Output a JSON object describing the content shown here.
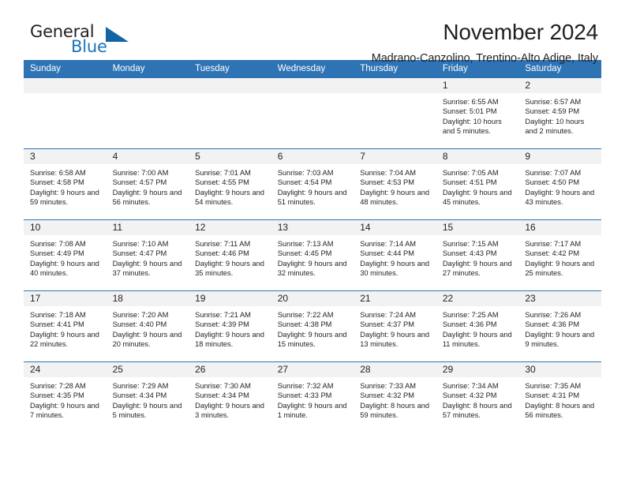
{
  "brand": {
    "name_part1": "General",
    "name_part2": "Blue",
    "logo_icon": "blue-triangle-icon"
  },
  "header": {
    "month_title": "November 2024",
    "location": "Madrano-Canzolino, Trentino-Alto Adige, Italy"
  },
  "colors": {
    "header_blue": "#2e74b5",
    "brand_blue": "#1a74bb",
    "daynum_bg": "#f2f2f2",
    "text": "#231f20"
  },
  "calendar": {
    "weekday_headers": [
      "Sunday",
      "Monday",
      "Tuesday",
      "Wednesday",
      "Thursday",
      "Friday",
      "Saturday"
    ],
    "weeks": [
      [
        {
          "day": "",
          "sunrise": "",
          "sunset": "",
          "daylight": ""
        },
        {
          "day": "",
          "sunrise": "",
          "sunset": "",
          "daylight": ""
        },
        {
          "day": "",
          "sunrise": "",
          "sunset": "",
          "daylight": ""
        },
        {
          "day": "",
          "sunrise": "",
          "sunset": "",
          "daylight": ""
        },
        {
          "day": "",
          "sunrise": "",
          "sunset": "",
          "daylight": ""
        },
        {
          "day": "1",
          "sunrise": "Sunrise: 6:55 AM",
          "sunset": "Sunset: 5:01 PM",
          "daylight": "Daylight: 10 hours and 5 minutes."
        },
        {
          "day": "2",
          "sunrise": "Sunrise: 6:57 AM",
          "sunset": "Sunset: 4:59 PM",
          "daylight": "Daylight: 10 hours and 2 minutes."
        }
      ],
      [
        {
          "day": "3",
          "sunrise": "Sunrise: 6:58 AM",
          "sunset": "Sunset: 4:58 PM",
          "daylight": "Daylight: 9 hours and 59 minutes."
        },
        {
          "day": "4",
          "sunrise": "Sunrise: 7:00 AM",
          "sunset": "Sunset: 4:57 PM",
          "daylight": "Daylight: 9 hours and 56 minutes."
        },
        {
          "day": "5",
          "sunrise": "Sunrise: 7:01 AM",
          "sunset": "Sunset: 4:55 PM",
          "daylight": "Daylight: 9 hours and 54 minutes."
        },
        {
          "day": "6",
          "sunrise": "Sunrise: 7:03 AM",
          "sunset": "Sunset: 4:54 PM",
          "daylight": "Daylight: 9 hours and 51 minutes."
        },
        {
          "day": "7",
          "sunrise": "Sunrise: 7:04 AM",
          "sunset": "Sunset: 4:53 PM",
          "daylight": "Daylight: 9 hours and 48 minutes."
        },
        {
          "day": "8",
          "sunrise": "Sunrise: 7:05 AM",
          "sunset": "Sunset: 4:51 PM",
          "daylight": "Daylight: 9 hours and 45 minutes."
        },
        {
          "day": "9",
          "sunrise": "Sunrise: 7:07 AM",
          "sunset": "Sunset: 4:50 PM",
          "daylight": "Daylight: 9 hours and 43 minutes."
        }
      ],
      [
        {
          "day": "10",
          "sunrise": "Sunrise: 7:08 AM",
          "sunset": "Sunset: 4:49 PM",
          "daylight": "Daylight: 9 hours and 40 minutes."
        },
        {
          "day": "11",
          "sunrise": "Sunrise: 7:10 AM",
          "sunset": "Sunset: 4:47 PM",
          "daylight": "Daylight: 9 hours and 37 minutes."
        },
        {
          "day": "12",
          "sunrise": "Sunrise: 7:11 AM",
          "sunset": "Sunset: 4:46 PM",
          "daylight": "Daylight: 9 hours and 35 minutes."
        },
        {
          "day": "13",
          "sunrise": "Sunrise: 7:13 AM",
          "sunset": "Sunset: 4:45 PM",
          "daylight": "Daylight: 9 hours and 32 minutes."
        },
        {
          "day": "14",
          "sunrise": "Sunrise: 7:14 AM",
          "sunset": "Sunset: 4:44 PM",
          "daylight": "Daylight: 9 hours and 30 minutes."
        },
        {
          "day": "15",
          "sunrise": "Sunrise: 7:15 AM",
          "sunset": "Sunset: 4:43 PM",
          "daylight": "Daylight: 9 hours and 27 minutes."
        },
        {
          "day": "16",
          "sunrise": "Sunrise: 7:17 AM",
          "sunset": "Sunset: 4:42 PM",
          "daylight": "Daylight: 9 hours and 25 minutes."
        }
      ],
      [
        {
          "day": "17",
          "sunrise": "Sunrise: 7:18 AM",
          "sunset": "Sunset: 4:41 PM",
          "daylight": "Daylight: 9 hours and 22 minutes."
        },
        {
          "day": "18",
          "sunrise": "Sunrise: 7:20 AM",
          "sunset": "Sunset: 4:40 PM",
          "daylight": "Daylight: 9 hours and 20 minutes."
        },
        {
          "day": "19",
          "sunrise": "Sunrise: 7:21 AM",
          "sunset": "Sunset: 4:39 PM",
          "daylight": "Daylight: 9 hours and 18 minutes."
        },
        {
          "day": "20",
          "sunrise": "Sunrise: 7:22 AM",
          "sunset": "Sunset: 4:38 PM",
          "daylight": "Daylight: 9 hours and 15 minutes."
        },
        {
          "day": "21",
          "sunrise": "Sunrise: 7:24 AM",
          "sunset": "Sunset: 4:37 PM",
          "daylight": "Daylight: 9 hours and 13 minutes."
        },
        {
          "day": "22",
          "sunrise": "Sunrise: 7:25 AM",
          "sunset": "Sunset: 4:36 PM",
          "daylight": "Daylight: 9 hours and 11 minutes."
        },
        {
          "day": "23",
          "sunrise": "Sunrise: 7:26 AM",
          "sunset": "Sunset: 4:36 PM",
          "daylight": "Daylight: 9 hours and 9 minutes."
        }
      ],
      [
        {
          "day": "24",
          "sunrise": "Sunrise: 7:28 AM",
          "sunset": "Sunset: 4:35 PM",
          "daylight": "Daylight: 9 hours and 7 minutes."
        },
        {
          "day": "25",
          "sunrise": "Sunrise: 7:29 AM",
          "sunset": "Sunset: 4:34 PM",
          "daylight": "Daylight: 9 hours and 5 minutes."
        },
        {
          "day": "26",
          "sunrise": "Sunrise: 7:30 AM",
          "sunset": "Sunset: 4:34 PM",
          "daylight": "Daylight: 9 hours and 3 minutes."
        },
        {
          "day": "27",
          "sunrise": "Sunrise: 7:32 AM",
          "sunset": "Sunset: 4:33 PM",
          "daylight": "Daylight: 9 hours and 1 minute."
        },
        {
          "day": "28",
          "sunrise": "Sunrise: 7:33 AM",
          "sunset": "Sunset: 4:32 PM",
          "daylight": "Daylight: 8 hours and 59 minutes."
        },
        {
          "day": "29",
          "sunrise": "Sunrise: 7:34 AM",
          "sunset": "Sunset: 4:32 PM",
          "daylight": "Daylight: 8 hours and 57 minutes."
        },
        {
          "day": "30",
          "sunrise": "Sunrise: 7:35 AM",
          "sunset": "Sunset: 4:31 PM",
          "daylight": "Daylight: 8 hours and 56 minutes."
        }
      ]
    ]
  }
}
